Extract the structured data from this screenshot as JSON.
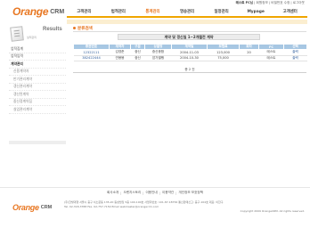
{
  "top_info": {
    "prefix": "테스트",
    "name": "FC님",
    "links": [
      "회원정보",
      "비밀번호 수정",
      "로그아웃"
    ]
  },
  "logo": {
    "mark": "Orange",
    "word": "CRM"
  },
  "gnb": {
    "items": [
      {
        "label": "고객관리"
      },
      {
        "label": "법적관리"
      },
      {
        "label": "통계관리"
      },
      {
        "label": "영송관리"
      },
      {
        "label": "일정관리"
      },
      {
        "label": "Mypage"
      },
      {
        "label": "고객센터"
      }
    ]
  },
  "sidebar": {
    "results_title": "Results",
    "results_sub": "실적관리",
    "items": [
      {
        "label": "업적집계",
        "type": "item"
      },
      {
        "label": "업적입력",
        "type": "item"
      },
      {
        "label": "계약관리",
        "type": "head"
      },
      {
        "label": "신용계약자",
        "type": "sub"
      },
      {
        "label": "만기관리계약",
        "type": "sub"
      },
      {
        "label": "갱신관리계약",
        "type": "sub"
      },
      {
        "label": "갱신된계약",
        "type": "sub"
      },
      {
        "label": "중신정계약집",
        "type": "sub"
      },
      {
        "label": "실업관리계약",
        "type": "sub"
      }
    ]
  },
  "main": {
    "title": "분류검색",
    "filter_label": "계약 및 갱신일 1~2개월전 계약",
    "table": {
      "columns": [
        "증권번호",
        "계약자",
        "구분",
        "상품명",
        "계약일",
        "보험료",
        "회차",
        "FC",
        "선택"
      ],
      "rows": [
        [
          "12322111",
          "김영준",
          "중신",
          "중신종합",
          "2004-11-03",
          "123,000",
          "20",
          "테스트",
          "출력"
        ],
        [
          "382422444",
          "연봉봉",
          "중신",
          "암가별행",
          "2004-10-30",
          "75,000",
          "",
          "테스트",
          "출력"
        ]
      ]
    },
    "total_text": "총 2 건"
  },
  "footer": {
    "links": [
      "회사소개",
      "오렌지스토리",
      "이용안내",
      "이용약관",
      "개인정보 보호정책"
    ],
    "line1": "(주)한빛대행 서울시 중구 서소문동 135-20 동성빌딩 5층 100-100호 사업자번호: 101-87-18756 통신판매신고: 중구-104호 대표: 이한구",
    "line2": "Tel. 02-318-3788 Fax. 02-757-7150 Email webmaster@orangecrm.com",
    "copyright": "Copyright 2009 OrangeCRM. All rights reserved."
  },
  "colors": {
    "accent": "#e87722",
    "gnb_underline": "#f0a500",
    "table_header": "#a7c7e3"
  }
}
